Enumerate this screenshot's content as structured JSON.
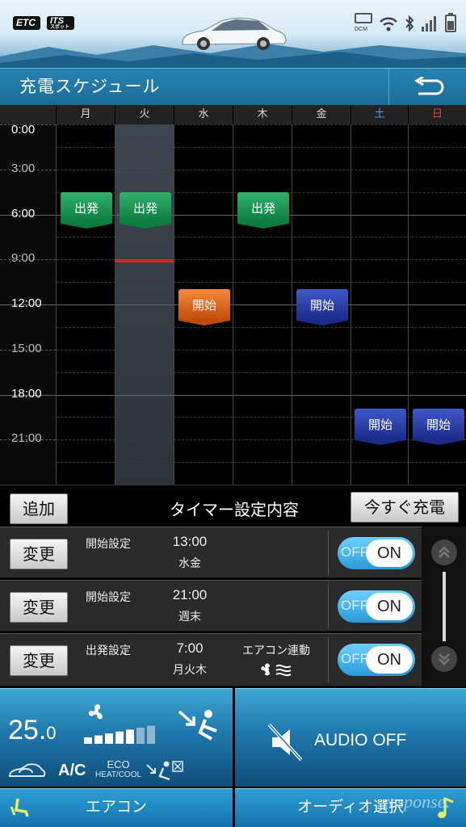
{
  "status_bar": {
    "etc_label": "ETC",
    "its_label": "ITS",
    "its_sub": "スポット",
    "dcm_label": "DCM",
    "icons": [
      "wifi-icon",
      "bluetooth-icon",
      "signal-icon",
      "battery-icon"
    ]
  },
  "header": {
    "title": "充電スケジュール",
    "back_icon": "back-arrow-icon"
  },
  "schedule": {
    "days": [
      "月",
      "火",
      "水",
      "木",
      "金",
      "土",
      "日"
    ],
    "day_colors": [
      "#dddddd",
      "#dddddd",
      "#dddddd",
      "#dddddd",
      "#dddddd",
      "#4aa3ff",
      "#e0453a"
    ],
    "selected_day": "火",
    "time_labels": [
      "0:00",
      "3:00",
      "6:00",
      "9:00",
      "12:00",
      "15:00",
      "18:00",
      "21:00"
    ],
    "events": [
      {
        "day": "月",
        "label": "出発",
        "kind": "departure",
        "time": "7:00"
      },
      {
        "day": "火",
        "label": "出発",
        "kind": "departure",
        "time": "7:00"
      },
      {
        "day": "木",
        "label": "出発",
        "kind": "departure",
        "time": "7:00"
      },
      {
        "day": "水",
        "label": "開始",
        "kind": "start",
        "time": "13:00",
        "color": "orange"
      },
      {
        "day": "金",
        "label": "開始",
        "kind": "start",
        "time": "13:00",
        "color": "blue"
      },
      {
        "day": "土",
        "label": "開始",
        "kind": "start",
        "time": "21:00",
        "color": "blue"
      },
      {
        "day": "日",
        "label": "開始",
        "kind": "start",
        "time": "21:00",
        "color": "blue"
      }
    ],
    "current_time_marker_color": "#d62626"
  },
  "timer_panel": {
    "add_label": "追加",
    "title": "タイマー設定内容",
    "charge_now_label": "今すぐ充電",
    "rows": [
      {
        "change_label": "変更",
        "type": "開始設定",
        "time": "13:00",
        "days": "水金",
        "ac_label": "",
        "toggle_off": "OFF",
        "toggle_on": "ON"
      },
      {
        "change_label": "変更",
        "type": "開始設定",
        "time": "21:00",
        "days": "週末",
        "ac_label": "",
        "toggle_off": "OFF",
        "toggle_on": "ON"
      },
      {
        "change_label": "変更",
        "type": "出発設定",
        "time": "7:00",
        "days": "月火木",
        "ac_label": "エアコン連動",
        "toggle_off": "OFF",
        "toggle_on": "ON"
      }
    ]
  },
  "climate": {
    "temp_main": "25.",
    "temp_decimal": "0",
    "fan_level": 5,
    "fan_max": 7,
    "ac_label": "A/C",
    "eco_label": "ECO",
    "eco_sub": "HEAT/COOL",
    "tab_label": "エアコン"
  },
  "audio": {
    "label": "AUDIO OFF",
    "tab_label": "オーディオ選択"
  },
  "watermark": "response."
}
